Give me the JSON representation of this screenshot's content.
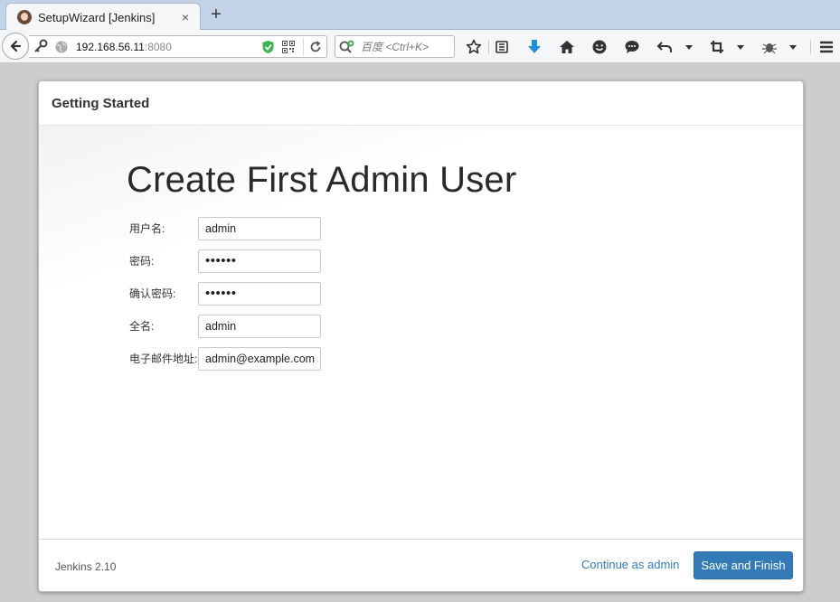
{
  "browser": {
    "tab": {
      "title": "SetupWizard [Jenkins]",
      "close_glyph": "×",
      "favicon": "jenkins-icon"
    },
    "new_tab_glyph": "+",
    "url": {
      "host": "192.168.56.11",
      "port": ":8080"
    },
    "search_placeholder": "百度 <Ctrl+K>",
    "toolbar_icons": [
      "star-icon",
      "reading-list-icon",
      "download-icon",
      "home-icon",
      "emoji-icon",
      "chat-icon",
      "undo-icon",
      "crop-icon",
      "bug-icon",
      "menu-icon"
    ]
  },
  "wizard": {
    "header": "Getting Started",
    "title": "Create First Admin User",
    "fields": {
      "username": {
        "label": "用户名:",
        "value": "admin"
      },
      "password": {
        "label": "密码:",
        "value": "••••••"
      },
      "confirm_password": {
        "label": "确认密码:",
        "value": "••••••"
      },
      "full_name": {
        "label": "全名:",
        "value": "admin"
      },
      "email": {
        "label": "电子邮件地址:",
        "value": "admin@example.com"
      }
    },
    "footer": {
      "version": "Jenkins 2.10",
      "continue_label": "Continue as admin",
      "save_label": "Save and Finish"
    }
  },
  "colors": {
    "accent": "#337ab7",
    "tabstrip": "#c2d3e8"
  }
}
